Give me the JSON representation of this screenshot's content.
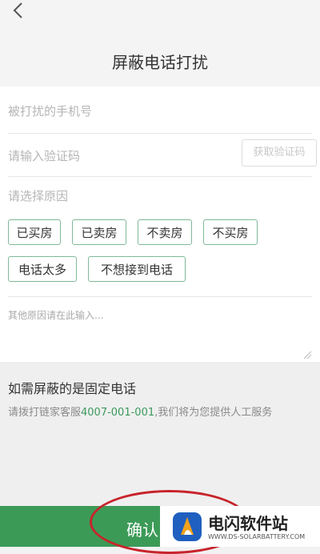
{
  "header": {
    "title": "屏蔽电话打扰"
  },
  "form": {
    "phone_placeholder": "被打扰的手机号",
    "code_placeholder": "请输入验证码",
    "code_button": "获取验证码",
    "reason_label": "请选择原因",
    "reasons": [
      "已买房",
      "已卖房",
      "不卖房",
      "不买房",
      "电话太多",
      "不想接到电话"
    ],
    "other_placeholder": "其他原因请在此输入..."
  },
  "info": {
    "title": "如需屏蔽的是固定电话",
    "desc_prefix": "请拨打链家客服",
    "phone": "4007-001-001",
    "desc_suffix": ",我们将为您提供人工服务"
  },
  "footer": {
    "confirm": "确认"
  },
  "watermark": {
    "name": "电闪软件站",
    "url": "WWW.DS-SOLARBATTERY.COM"
  },
  "colors": {
    "accent": "#3c9a57",
    "tag_border": "#7fb99a",
    "annotation": "#c8242b"
  }
}
